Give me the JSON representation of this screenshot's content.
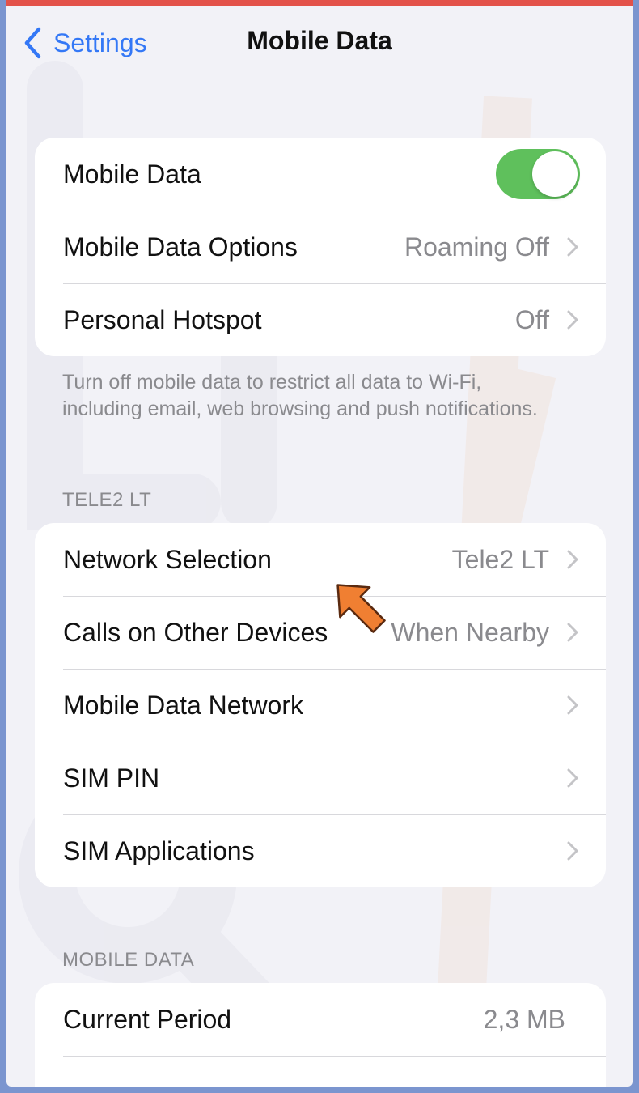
{
  "nav": {
    "back_label": "Settings",
    "title": "Mobile Data"
  },
  "group1": {
    "mobile_data": {
      "label": "Mobile Data",
      "toggle_on": true,
      "toggle_color": "#5fc05c"
    },
    "options": {
      "label": "Mobile Data Options",
      "value": "Roaming Off"
    },
    "hotspot": {
      "label": "Personal Hotspot",
      "value": "Off"
    }
  },
  "footnote": "Turn off mobile data to restrict all data to Wi-Fi, including email, web browsing and push notifications.",
  "carrier_section": {
    "header": "TELE2 LT",
    "rows": [
      {
        "label": "Network Selection",
        "value": "Tele2 LT"
      },
      {
        "label": "Calls on Other Devices",
        "value": "When Nearby"
      },
      {
        "label": "Mobile Data Network",
        "value": ""
      },
      {
        "label": "SIM PIN",
        "value": ""
      },
      {
        "label": "SIM Applications",
        "value": ""
      }
    ]
  },
  "usage_section": {
    "header": "MOBILE DATA",
    "current_period": {
      "label": "Current Period",
      "value": "2,3 MB"
    }
  },
  "colors": {
    "accent": "#3478f6",
    "annotation_arrow": "#f07f32",
    "frame_border": "#7b95cf",
    "top_bar": "#e3524a"
  },
  "icons": {
    "back": "chevron-left-icon",
    "disclosure": "chevron-right-icon",
    "annotation": "arrow-pointer-icon"
  }
}
